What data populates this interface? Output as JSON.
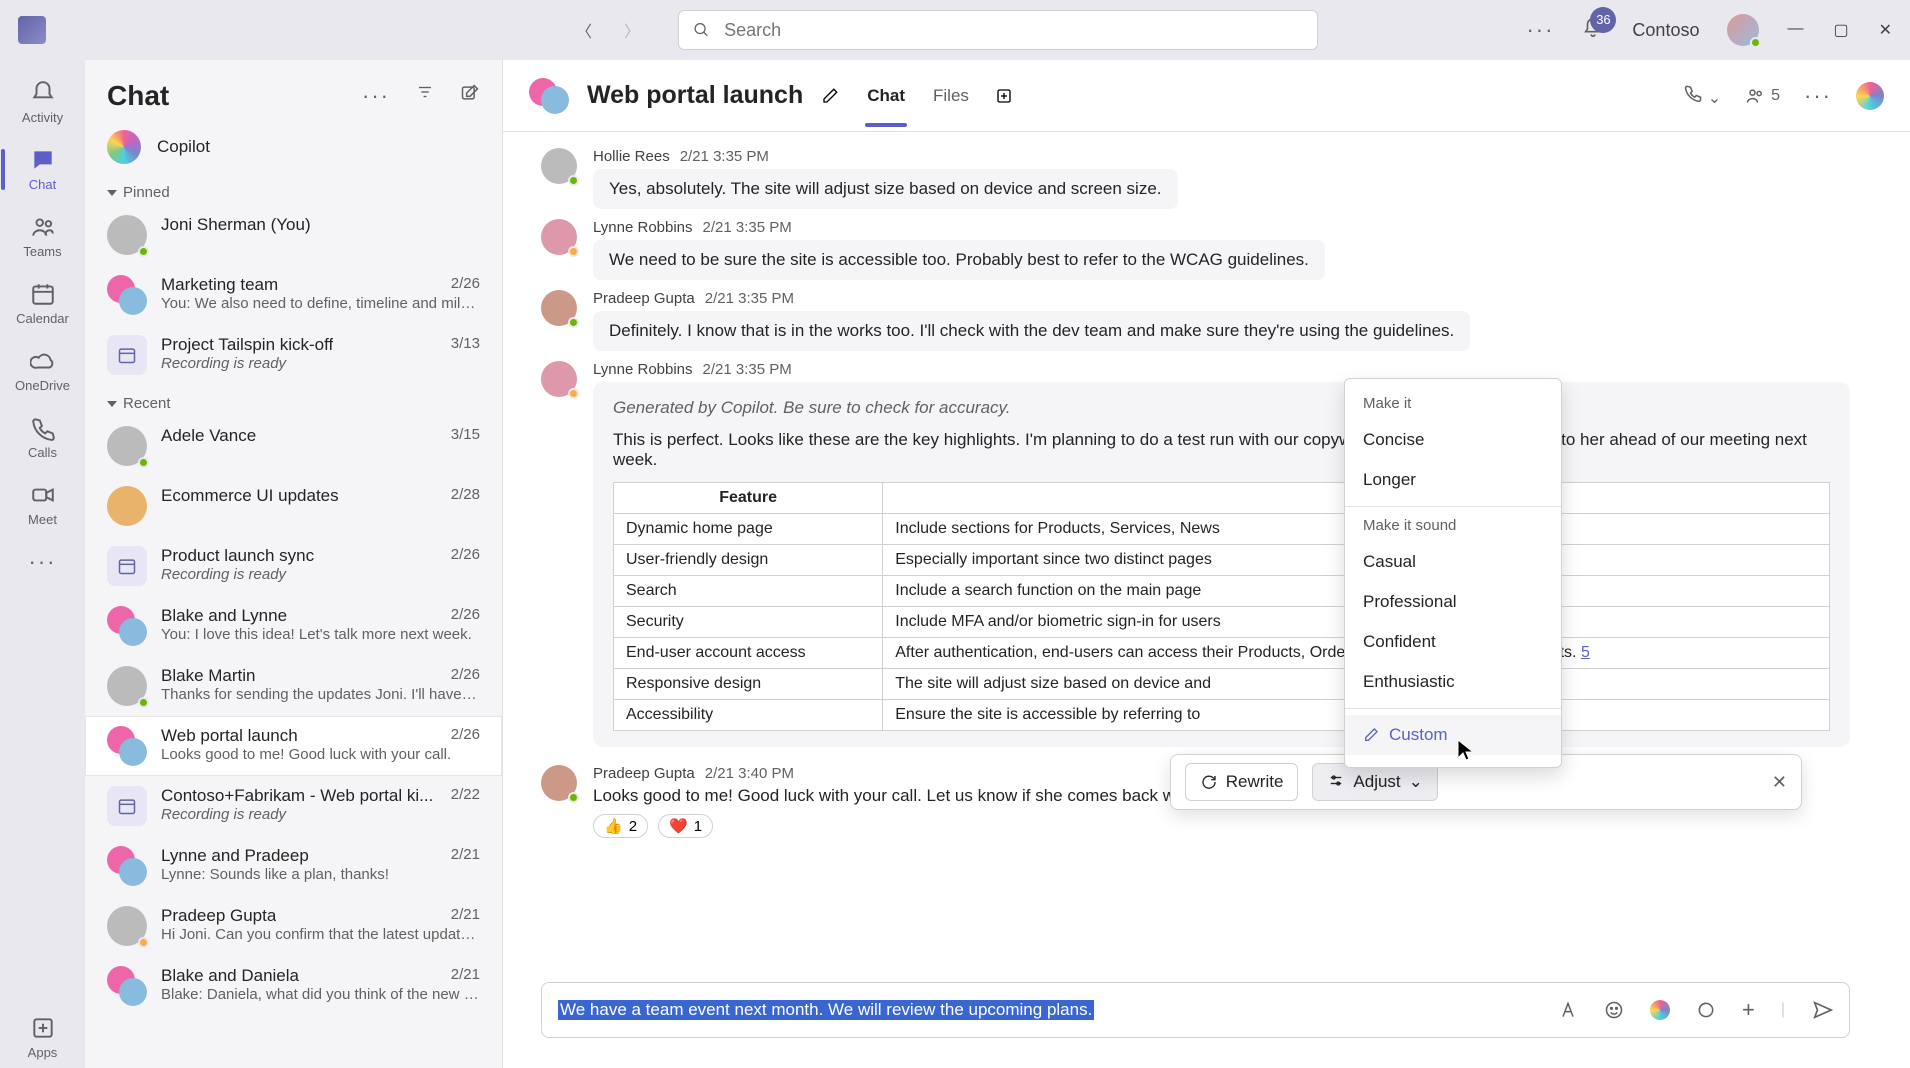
{
  "titlebar": {
    "search_placeholder": "Search",
    "notif_count": "36",
    "org": "Contoso"
  },
  "rail": [
    {
      "id": "activity",
      "label": "Activity"
    },
    {
      "id": "chat",
      "label": "Chat"
    },
    {
      "id": "teams",
      "label": "Teams"
    },
    {
      "id": "calendar",
      "label": "Calendar"
    },
    {
      "id": "onedrive",
      "label": "OneDrive"
    },
    {
      "id": "calls",
      "label": "Calls"
    },
    {
      "id": "meet",
      "label": "Meet"
    }
  ],
  "rail_apps_label": "Apps",
  "chatlist": {
    "title": "Chat",
    "copilot": "Copilot",
    "section_pinned": "Pinned",
    "section_recent": "Recent",
    "items": [
      {
        "title": "Joni Sherman (You)",
        "sub": "",
        "date": ""
      },
      {
        "title": "Marketing team",
        "sub": "You: We also need to define, timeline and miles...",
        "date": "2/26"
      },
      {
        "title": "Project Tailspin kick-off",
        "sub": "Recording is ready",
        "date": "3/13",
        "ital": true,
        "square": true
      },
      {
        "title": "Adele Vance",
        "sub": "",
        "date": "3/15"
      },
      {
        "title": "Ecommerce UI updates",
        "sub": "",
        "date": "2/28"
      },
      {
        "title": "Product launch sync",
        "sub": "Recording is ready",
        "date": "2/26",
        "ital": true,
        "square": true
      },
      {
        "title": "Blake and Lynne",
        "sub": "You: I love this idea! Let's talk more next week.",
        "date": "2/26",
        "pair": true
      },
      {
        "title": "Blake Martin",
        "sub": "Thanks for sending the updates Joni. I'll have s...",
        "date": "2/26"
      },
      {
        "title": "Web portal launch",
        "sub": "Looks good to me! Good luck with your call.",
        "date": "2/26",
        "pair": true,
        "sel": true
      },
      {
        "title": "Contoso+Fabrikam - Web portal ki...",
        "sub": "Recording is ready",
        "date": "2/22",
        "ital": true,
        "square": true
      },
      {
        "title": "Lynne and Pradeep",
        "sub": "Lynne: Sounds like a plan, thanks!",
        "date": "2/21",
        "pair": true
      },
      {
        "title": "Pradeep Gupta",
        "sub": "Hi Joni. Can you confirm that the latest updates...",
        "date": "2/21"
      },
      {
        "title": "Blake and Daniela",
        "sub": "Blake: Daniela, what did you think of the new d...",
        "date": "2/21",
        "pair": true
      }
    ]
  },
  "conversation": {
    "title": "Web portal launch",
    "tabs": [
      "Chat",
      "Files"
    ],
    "participants_count": "5",
    "messages": [
      {
        "author": "Hollie Rees",
        "time": "2/21 3:35 PM",
        "text": "Yes, absolutely. The site will adjust size based on device and screen size."
      },
      {
        "author": "Lynne Robbins",
        "time": "2/21 3:35 PM",
        "text": "We need to be sure the site is accessible too. Probably best to refer to the WCAG guidelines."
      },
      {
        "author": "Pradeep Gupta",
        "time": "2/21 3:35 PM",
        "text": "Definitely. I know that is in the works too. I'll check with the dev team and make sure they're using the guidelines."
      }
    ],
    "copilot_msg": {
      "author": "Lynne Robbins",
      "time": "2/21 3:35 PM",
      "generated": "Generated by Copilot. Be sure to check for accuracy.",
      "intro": "This is perfect. Looks like these are the key highlights. I'm planning to do a test run with our copywriter and will present this all to her ahead of our meeting next week.",
      "th_feature": "Feature",
      "rows": [
        {
          "f": "Dynamic home page",
          "d": "Include sections for Products, Services, News"
        },
        {
          "f": "User-friendly design",
          "d": "Especially important since two distinct pages"
        },
        {
          "f": "Search",
          "d": "Include a search function on the main page"
        },
        {
          "f": "Security",
          "d": "Include MFA and/or biometric sign-in for users"
        },
        {
          "f": "End-user account access",
          "d": "After authentication, end-users can access their Products, Orders, Invoices, and Support tickets."
        },
        {
          "f": "Responsive design",
          "d": "The site will adjust size based on device and"
        },
        {
          "f": "Accessibility",
          "d": "Ensure the site is accessible by referring to"
        }
      ],
      "link": "5"
    },
    "closing": {
      "author": "Pradeep Gupta",
      "time": "2/21 3:40 PM",
      "text": "Looks good to me! Good luck with your call. Let us know if she comes back with anything maybe we can help answer before the on-site meeting.",
      "reactions": [
        {
          "emoji": "👍",
          "count": "2"
        },
        {
          "emoji": "❤️",
          "count": "1"
        }
      ]
    }
  },
  "adjust_menu": {
    "hdr1": "Make it",
    "g1": [
      "Concise",
      "Longer"
    ],
    "hdr2": "Make it sound",
    "g2": [
      "Casual",
      "Professional",
      "Confident",
      "Enthusiastic"
    ],
    "custom": "Custom"
  },
  "copilot_toolbar": {
    "rewrite": "Rewrite",
    "adjust": "Adjust"
  },
  "compose": {
    "text": "We have a team event next month. We will review the upcoming plans."
  }
}
